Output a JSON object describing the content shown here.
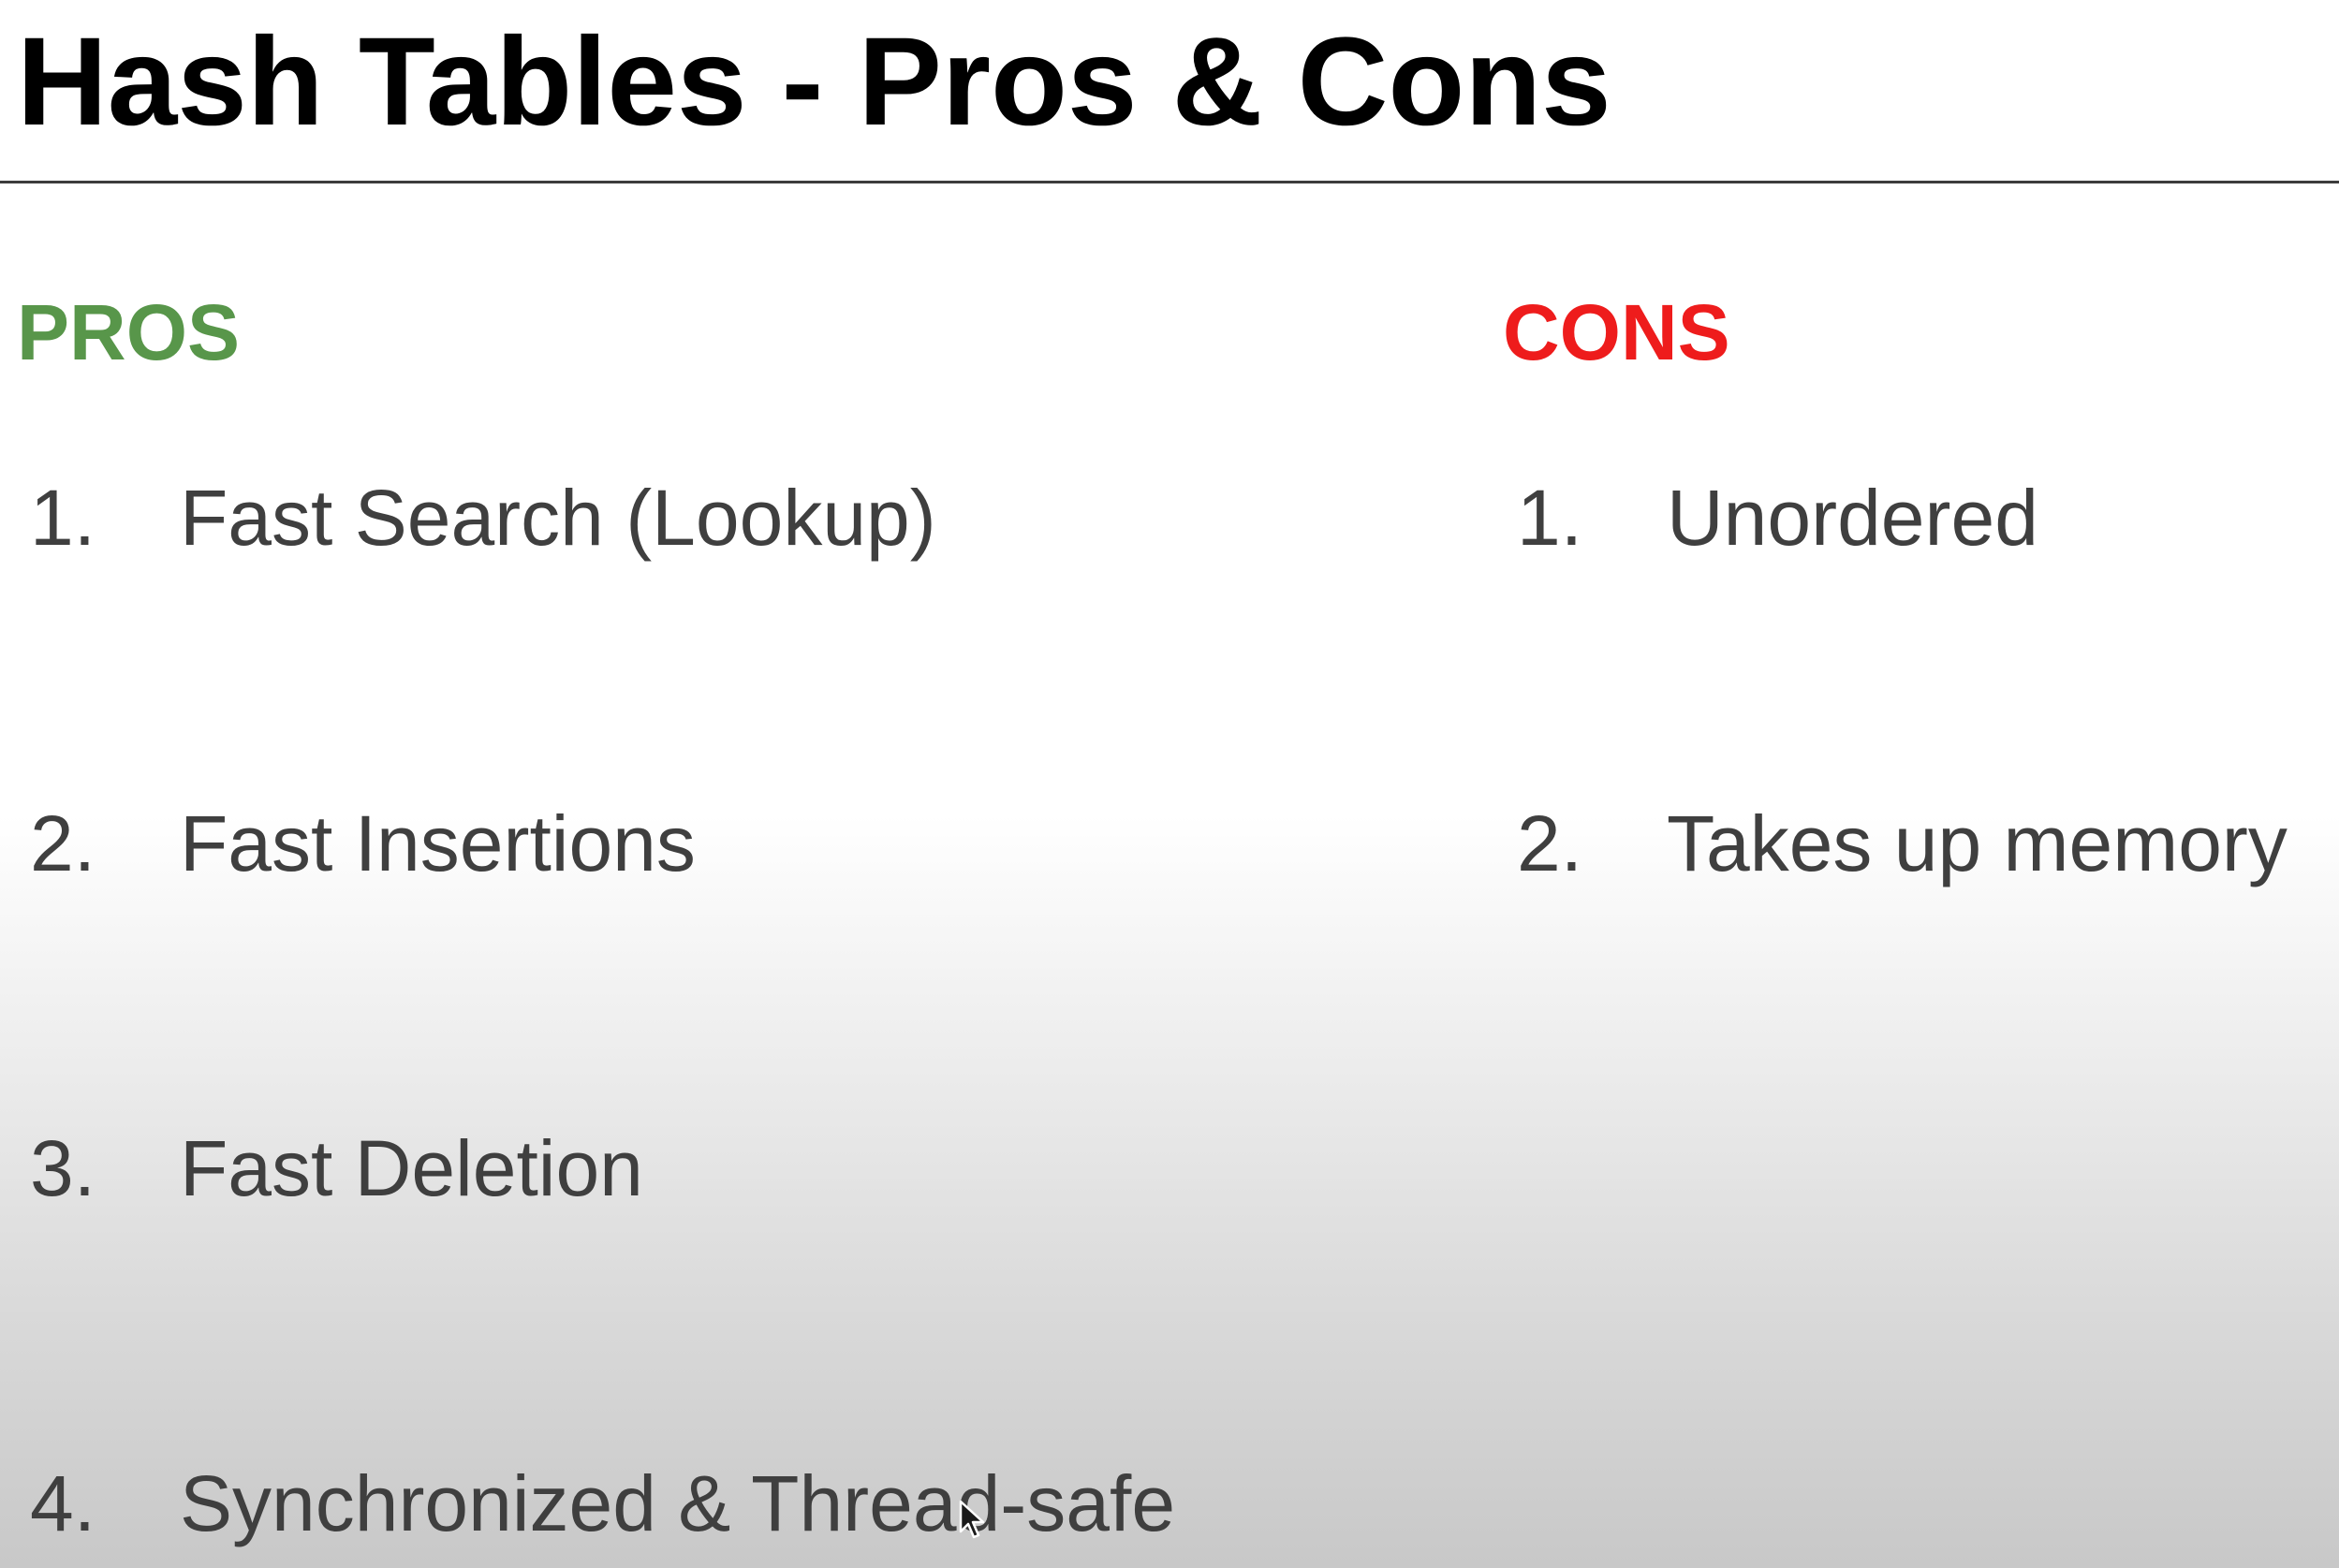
{
  "slide": {
    "title": "Hash Tables - Pros & Cons"
  },
  "pros": {
    "heading": "PROS",
    "color": "#58964a",
    "items": [
      {
        "number": "1.",
        "text": "Fast Search (Lookup)"
      },
      {
        "number": "2.",
        "text": "Fast Insertions"
      },
      {
        "number": "3.",
        "text": "Fast Deletion"
      },
      {
        "number": "4.",
        "text": "Synchronized & Thread-safe"
      }
    ]
  },
  "cons": {
    "heading": "CONS",
    "color": "#ee1c1c",
    "items": [
      {
        "number": "1.",
        "text": "Unordered"
      },
      {
        "number": "2.",
        "text": "Takes up memory"
      }
    ]
  },
  "cursor": {
    "icon": "mouse-pointer-icon"
  }
}
